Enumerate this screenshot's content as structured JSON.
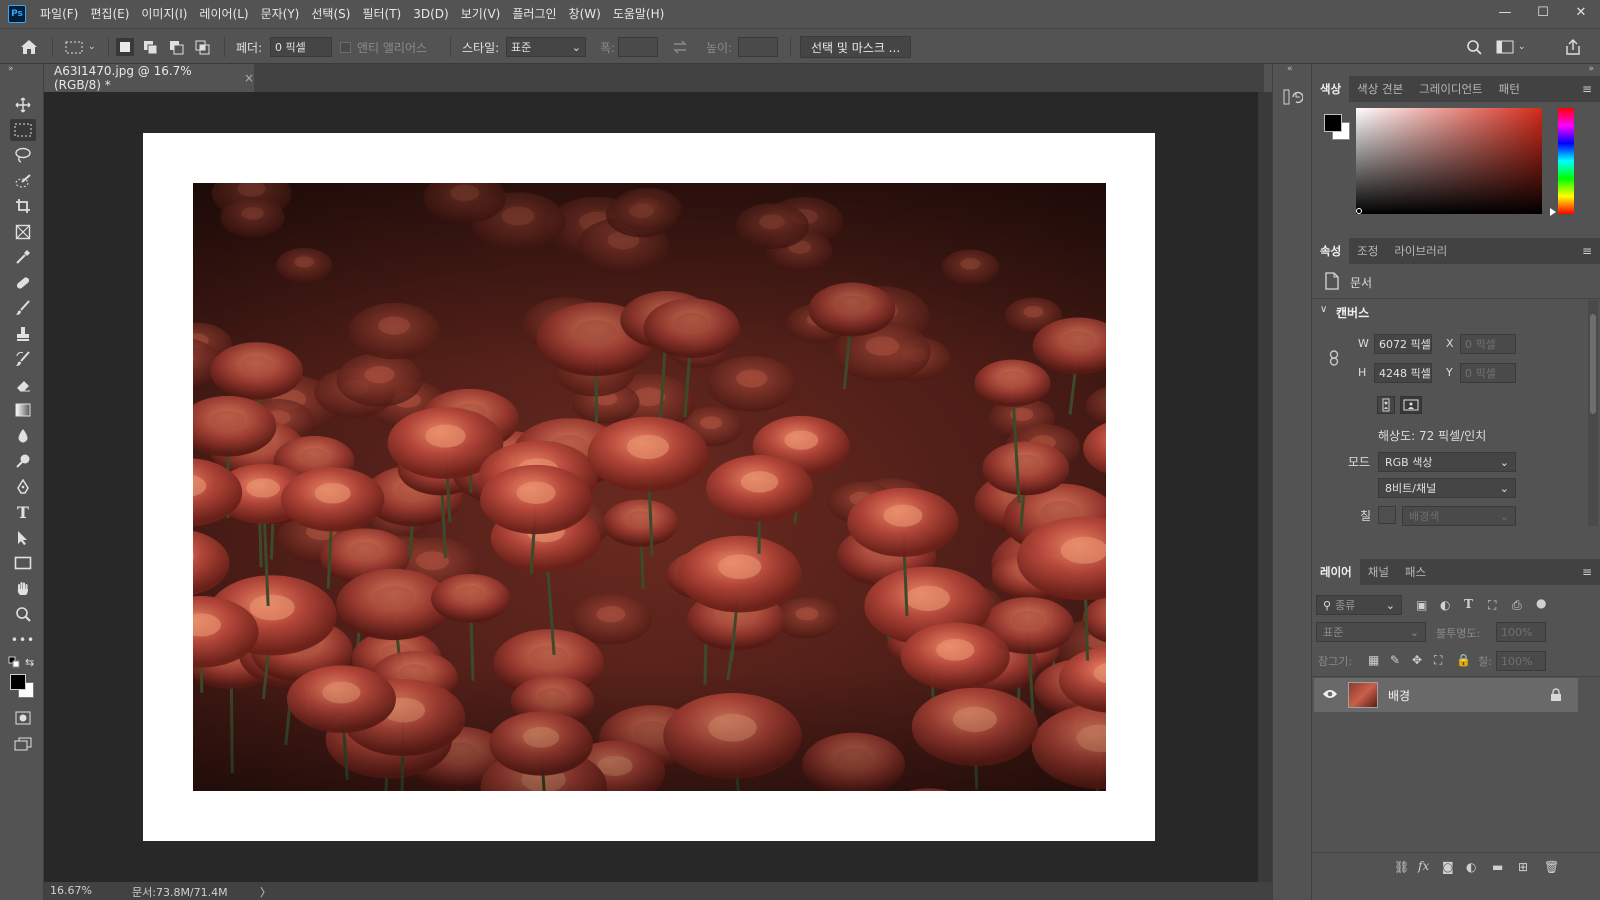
{
  "app": {
    "logo": "Ps"
  },
  "menu": [
    "파일(F)",
    "편집(E)",
    "이미지(I)",
    "레이어(L)",
    "문자(Y)",
    "선택(S)",
    "필터(T)",
    "3D(D)",
    "보기(V)",
    "플러그인",
    "창(W)",
    "도움말(H)"
  ],
  "window_controls": {
    "minimize": "—",
    "maximize": "☐",
    "close": "✕"
  },
  "options": {
    "feather_label": "페더:",
    "feather_value": "0 픽셀",
    "antialias_label": "앤티 앨리어스",
    "style_label": "스타일:",
    "style_value": "표준",
    "width_label": "폭:",
    "height_label": "높이:",
    "select_mask_button": "선택 및 마스크 ..."
  },
  "document": {
    "tab_title": "A63I1470.jpg @ 16.7% (RGB/8) *",
    "tab_close": "×"
  },
  "status": {
    "zoom": "16.67%",
    "doc_info": "문서:73.8M/71.4M",
    "arrow": "〉"
  },
  "color_panel": {
    "tabs": [
      "색상",
      "색상 견본",
      "그레이디언트",
      "패턴"
    ],
    "foreground": "#000000",
    "background": "#ffffff",
    "hue_color": "#d42a1a"
  },
  "properties_panel": {
    "tabs": [
      "속성",
      "조정",
      "라이브러리"
    ],
    "doc_label": "문서",
    "canvas_section": "캔버스",
    "w_label": "W",
    "w_value": "6072 픽셀",
    "h_label": "H",
    "h_value": "4248 픽셀",
    "x_label": "X",
    "x_value": "0 픽셀",
    "y_label": "Y",
    "y_value": "0 픽셀",
    "resolution": "해상도: 72 픽셀/인치",
    "mode_label": "모드",
    "mode_value": "RGB 색상",
    "depth_value": "8비트/채널",
    "fill_label": "칠",
    "fill_value": "배경색"
  },
  "layers_panel": {
    "tabs": [
      "레이어",
      "채널",
      "패스"
    ],
    "filter_placeholder": "종류",
    "blend_mode": "표준",
    "opacity_label": "불투명도:",
    "opacity_value": "100%",
    "lock_label": "잠그기:",
    "fill_label": "칠:",
    "fill_value": "100%",
    "layers": [
      {
        "name": "배경",
        "visible": true,
        "locked": true
      }
    ]
  }
}
